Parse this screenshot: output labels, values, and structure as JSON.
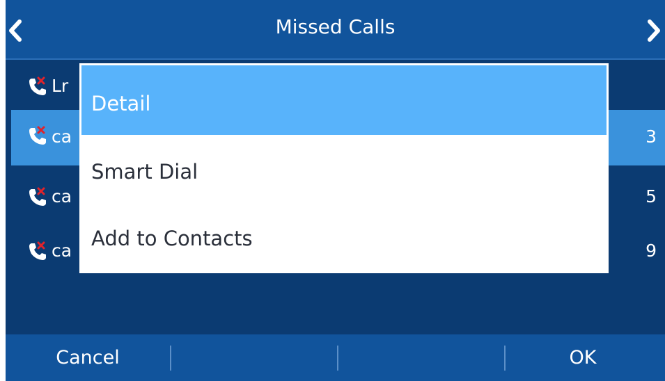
{
  "header": {
    "title": "Missed Calls"
  },
  "calls": [
    {
      "name": "Lr",
      "time": ""
    },
    {
      "name": "ca",
      "time": "3"
    },
    {
      "name": "ca",
      "time": "5"
    },
    {
      "name": "ca",
      "time": "9"
    }
  ],
  "menu": {
    "items": [
      {
        "label": "Detail"
      },
      {
        "label": "Smart Dial"
      },
      {
        "label": "Add to Contacts"
      }
    ],
    "selected_index": 0
  },
  "softkeys": {
    "left_label": "Cancel",
    "slot2_label": "",
    "slot3_label": "",
    "right_label": "OK"
  },
  "colors": {
    "title_bar": "#11549c",
    "background": "#0b3b72",
    "selected_row": "#3a92dc",
    "menu_highlight": "#58b3fb",
    "missed_mark": "#e0232b"
  },
  "icons": {
    "back": "chevron-left-icon",
    "forward": "chevron-right-icon",
    "missed_call": "missed-call-icon"
  }
}
